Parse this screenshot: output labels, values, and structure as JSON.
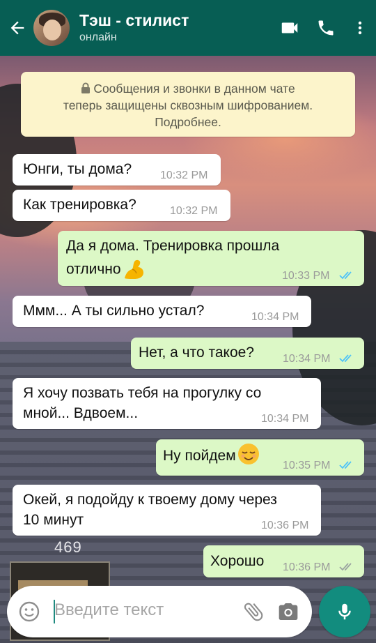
{
  "header": {
    "contact_name": "Тэш - стилист",
    "status": "онлайн",
    "colors": {
      "bar": "#075e54"
    },
    "icons": [
      "back-arrow-icon",
      "video-call-icon",
      "phone-icon",
      "more-vert-icon"
    ]
  },
  "encryption_notice": {
    "line1": "Сообщения и звонки в данном чате",
    "line2": "теперь защищены сквозным шифрованием.",
    "line3": "Подробнее."
  },
  "messages": [
    {
      "direction": "in",
      "text": "Юнги, ты дома?",
      "time": "10:32 PM"
    },
    {
      "direction": "in",
      "text": "Как тренировка?",
      "time": "10:32 PM"
    },
    {
      "direction": "out",
      "line1": "Да я дома. Тренировка прошла",
      "line2": "отлично",
      "emoji": "flexed-biceps",
      "time": "10:33 PM",
      "status": "read"
    },
    {
      "direction": "in",
      "text": "Ммм... А ты сильно устал?",
      "time": "10:34 PM"
    },
    {
      "direction": "out",
      "text": "Нет, а что такое?",
      "time": "10:34 PM",
      "status": "read"
    },
    {
      "direction": "in",
      "line1": "Я хочу позвать тебя на прогулку со",
      "line2": "мной... Вдвоем...",
      "time": "10:34 PM"
    },
    {
      "direction": "out",
      "text": "Ну пойдем",
      "emoji": "relieved-face",
      "time": "10:35 PM",
      "status": "read"
    },
    {
      "direction": "in",
      "line1": "Окей, я подойду к твоему дому через",
      "line2": "10 минут",
      "time": "10:36 PM"
    },
    {
      "direction": "out",
      "text": "Хорошо",
      "time": "10:36 PM",
      "status": "delivered"
    }
  ],
  "wallpaper": {
    "sign_text": "469"
  },
  "composer": {
    "placeholder": "Введите текст",
    "icons": [
      "emoji-icon",
      "attach-icon",
      "camera-icon",
      "mic-icon"
    ],
    "colors": {
      "mic_button": "#128c7e"
    }
  },
  "colors": {
    "incoming_bubble": "#ffffff",
    "outgoing_bubble": "#dcf8c6",
    "read_ticks": "#4fc3f7"
  }
}
